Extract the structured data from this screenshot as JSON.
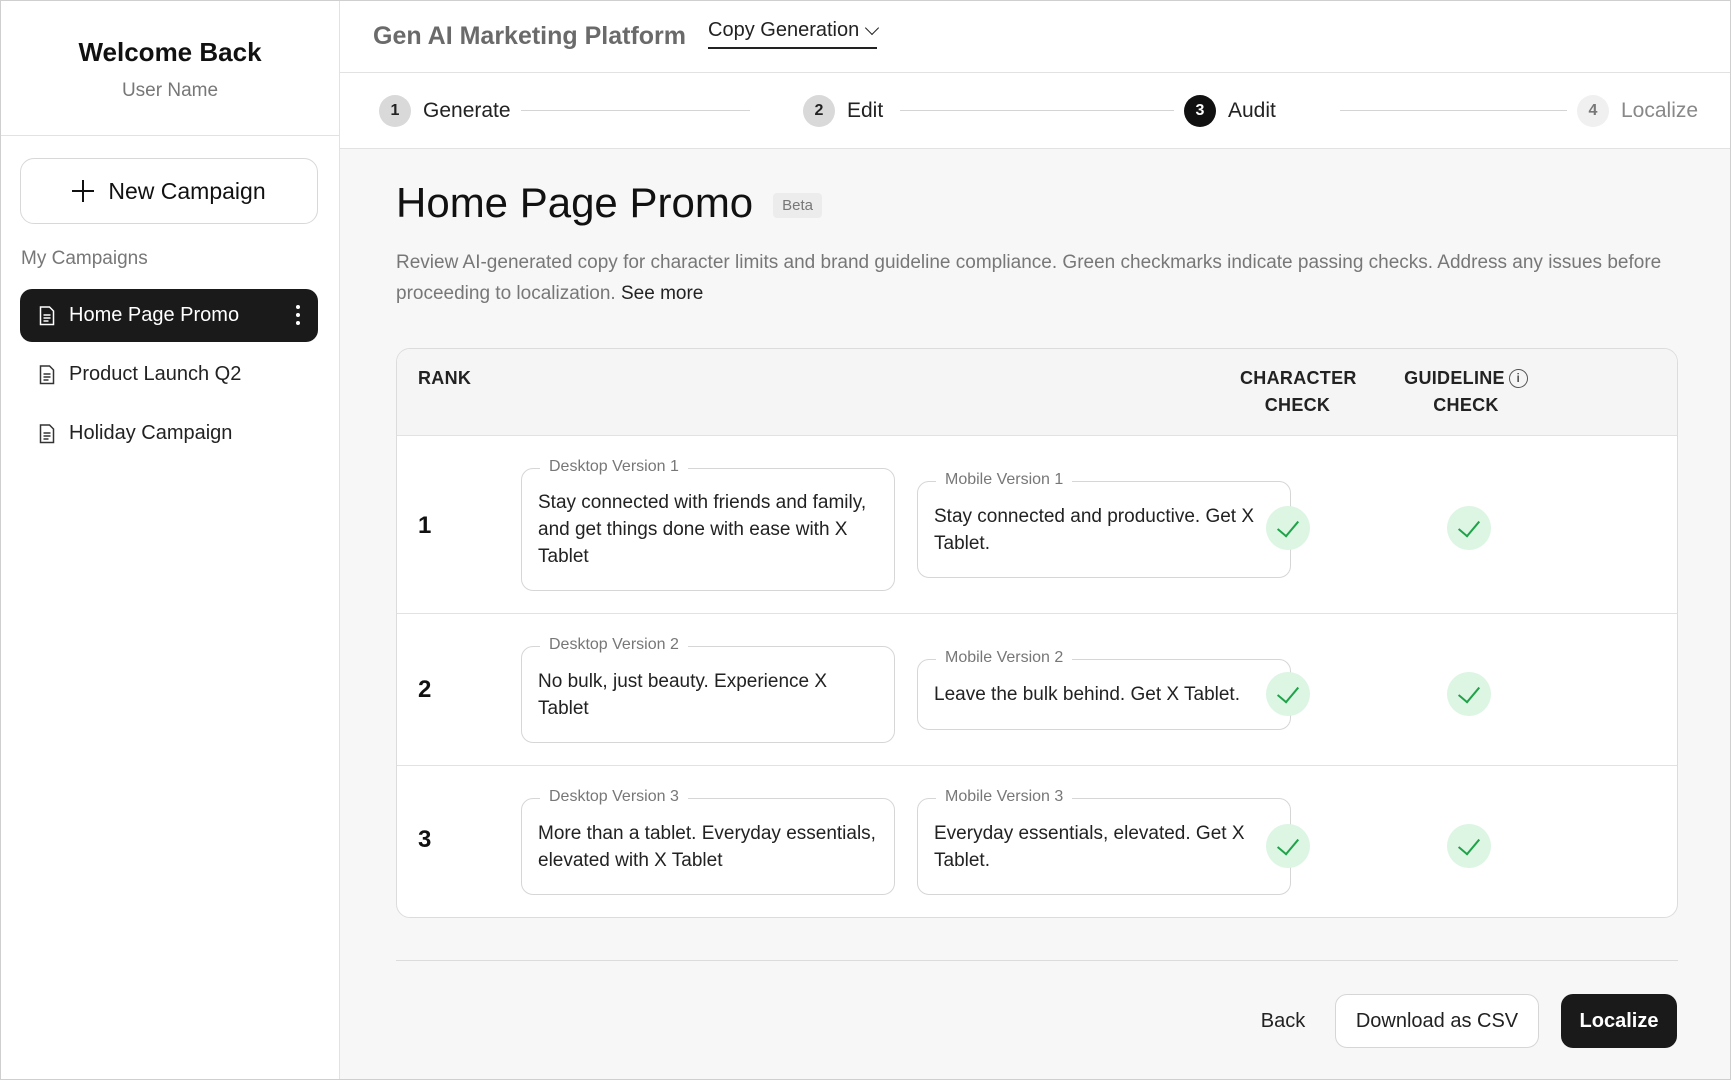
{
  "sidebar": {
    "welcome_title": "Welcome Back",
    "user_name": "User Name",
    "new_campaign_label": "New Campaign",
    "section_label": "My Campaigns",
    "campaigns": [
      {
        "label": "Home Page Promo",
        "active": true
      },
      {
        "label": "Product Launch Q2",
        "active": false
      },
      {
        "label": "Holiday Campaign",
        "active": false
      }
    ]
  },
  "header": {
    "platform_title": "Gen AI Marketing Platform",
    "mode_select": "Copy Generation"
  },
  "stepper": {
    "steps": [
      {
        "number": "1",
        "label": "Generate",
        "state": "done"
      },
      {
        "number": "2",
        "label": "Edit",
        "state": "done"
      },
      {
        "number": "3",
        "label": "Audit",
        "state": "current"
      },
      {
        "number": "4",
        "label": "Localize",
        "state": "future"
      }
    ]
  },
  "page": {
    "title": "Home Page Promo",
    "badge": "Beta",
    "description": "Review AI-generated copy for character limits and brand guideline compliance. Green checkmarks indicate passing checks. Address any issues before proceeding to localization.",
    "see_more": "See more"
  },
  "table": {
    "headers": {
      "rank": "RANK",
      "character_check_line1": "CHARACTER",
      "character_check_line2": "CHECK",
      "guideline_check_line1": "GUIDELINE",
      "guideline_check_line2": "CHECK"
    },
    "rows": [
      {
        "rank": "1",
        "desktop_label": "Desktop Version 1",
        "desktop_text": "Stay connected with friends and family, and get things done with ease with X Tablet",
        "mobile_label": "Mobile Version 1",
        "mobile_text": "Stay connected and productive. Get X Tablet.",
        "character_check": "pass",
        "guideline_check": "pass"
      },
      {
        "rank": "2",
        "desktop_label": "Desktop Version 2",
        "desktop_text": "No bulk, just beauty. Experience X Tablet",
        "mobile_label": "Mobile Version 2",
        "mobile_text": "Leave the bulk behind. Get X Tablet.",
        "character_check": "pass",
        "guideline_check": "pass"
      },
      {
        "rank": "3",
        "desktop_label": "Desktop Version 3",
        "desktop_text": "More than a tablet. Everyday essentials, elevated with X Tablet",
        "mobile_label": "Mobile Version 3",
        "mobile_text": "Everyday essentials, elevated. Get X Tablet.",
        "character_check": "pass",
        "guideline_check": "pass"
      }
    ]
  },
  "actions": {
    "back_label": "Back",
    "download_label": "Download as CSV",
    "localize_label": "Localize"
  },
  "colors": {
    "accent": "#1a1a1a",
    "check_bg": "#ddf5e3",
    "check_mark": "#1fa34a"
  }
}
